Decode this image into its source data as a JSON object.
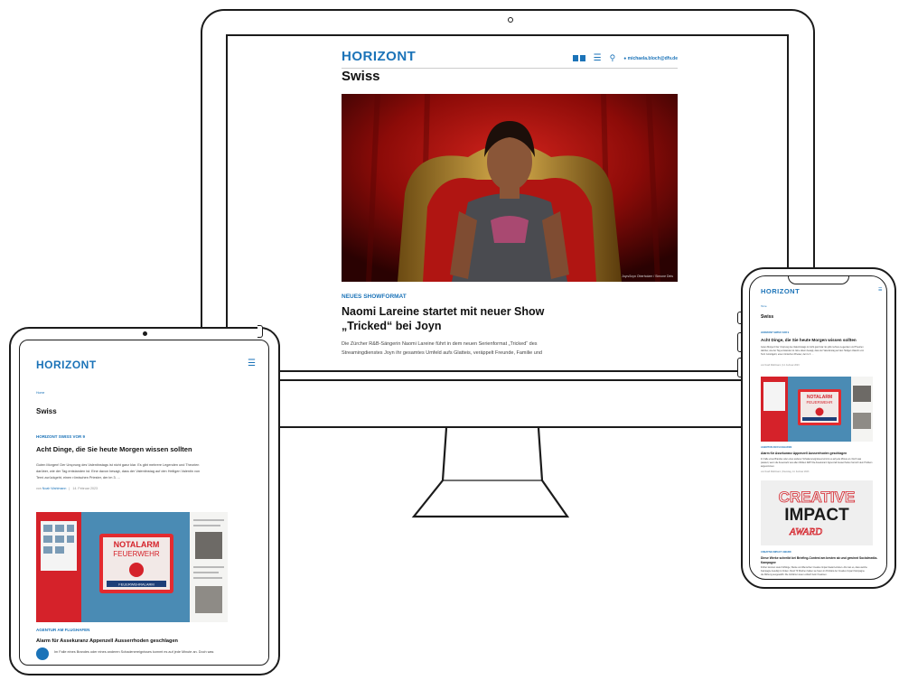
{
  "brand": {
    "logo": "HORIZONT",
    "accent_color": "#1b73b8"
  },
  "desktop": {
    "header": {
      "flag_icon": "swiss-flag-icon",
      "menu_icon": "hamburger-icon",
      "search_icon": "search-icon",
      "user_icon": "user-icon",
      "user_email": "michaela.bloch@dfv.de"
    },
    "section_title": "Swiss",
    "hero_caption": "Joyn/Joyn Oberholzer / Simone Deis",
    "article": {
      "kicker": "NEUES SHOWFORMAT",
      "title_line1": "Naomi Lareine startet mit neuer Show",
      "title_line2": "„Tricked“ bei Joyn",
      "body_line1": "Die Zürcher R&B-Sängerin Naomi Lareine führt in dem neuen Serienformat „Tricked“ des",
      "body_line2": "Streamingdienstes Joyn ihr gesamtes Umfeld aufs Glatteis, veräppelt Freunde, Familie und"
    }
  },
  "tablet": {
    "menu_icon": "hamburger-icon",
    "breadcrumb": "Home",
    "section_title": "Swiss",
    "article1": {
      "kicker": "HORIZONT SWISS VOR 9",
      "title": "Acht Dinge, die Sie heute Morgen wissen sollten",
      "body_line1": "Guten Morgen! Der Ursprung des Valentinstags ist nicht ganz klar. Es gibt mehrere Legenden und Theorien",
      "body_line2": "darüber, wie der Tag entstanden ist. Eine davon besagt, dass der Valentinstag auf den Heiligen Valentin von",
      "body_line3": "Terni zurückgeht, einen römischen Priester, der im 3. ...",
      "meta_prefix": "von",
      "author": "Noah Wahlmann",
      "date": "14. Februar 2023"
    },
    "article2": {
      "kicker": "AGENTUR AM FLUGHAFEN",
      "title": "Alarm für Assekuranz Appenzell Ausserrhoden geschlagen",
      "body_line1": "Im Falle eines Brandes oder eines anderen Schadenereignisses kommt es auf jede Minute an. Doch was"
    },
    "image_text": {
      "line1": "NOTALARM",
      "line2": "FEUERWEHR",
      "label": "FEUERWEHRALARM"
    }
  },
  "phone": {
    "menu_icon": "hamburger-icon",
    "breadcrumb": "Home",
    "section_title": "Swiss",
    "article1": {
      "kicker": "HORIZONT SWISS VOR 9",
      "title": "Acht Dinge, die Sie heute Morgen wissen sollten",
      "body_line1": "Guten Morgen! Der Ursprung des Valentinstags ist nicht ganz klar. Es gibt mehrere Legenden und Theorien",
      "body_line2": "darüber, wie der Tag entstanden ist. Eine davon besagt, dass der Valentinstag auf den Heiligen Valentin von",
      "body_line3": "Terni zurückgeht, einen römischen Priester, der im 3. ...",
      "meta": "von Noah Wahlmann   |   14. Februar 2023"
    },
    "article2": {
      "kicker": "AGENTUR AM FLUGHAFEN",
      "title": "Alarm für Assekuranz Appenzell Ausserrhoden geschlagen",
      "body_line1": "Im Falle eines Brandes oder eines anderen Schadenereignisses kommt es auf jede Minute an. Doch was",
      "body_line2": "passiert, wenn die Feuerwehr aus allen Wolken fällt? Die Assekuranz Appenzell Ausserrhoden hat sich dem Problem",
      "body_line3": "angenommen.",
      "meta": "von Noah Wahlmann   |   Dienstag, 14. Februar 2023"
    },
    "image2_text": {
      "line1": "CREATIVE",
      "line2": "IMPACT",
      "line3": "AWARD"
    },
    "article3": {
      "kicker": "CREATIVE IMPACT AWARD",
      "title": "Diese Werke schreibt bei Briefing-Contest am besten ab und gewinnt Socialmedia-Kampagne",
      "body_line1": "Früher konnten viele Frühlinge, Werke und Menschen Creative Impact Award erleben. Als man es, dass welche",
      "body_line2": "Kampagne beteiligt zu finden. Rund 70 Wochen haben sie freien im Portraits der Creative Impact Kampagne",
      "body_line3": "die Wirkung ausgewählt. Die Verfahren lesen einfach beim Kreativen."
    }
  }
}
